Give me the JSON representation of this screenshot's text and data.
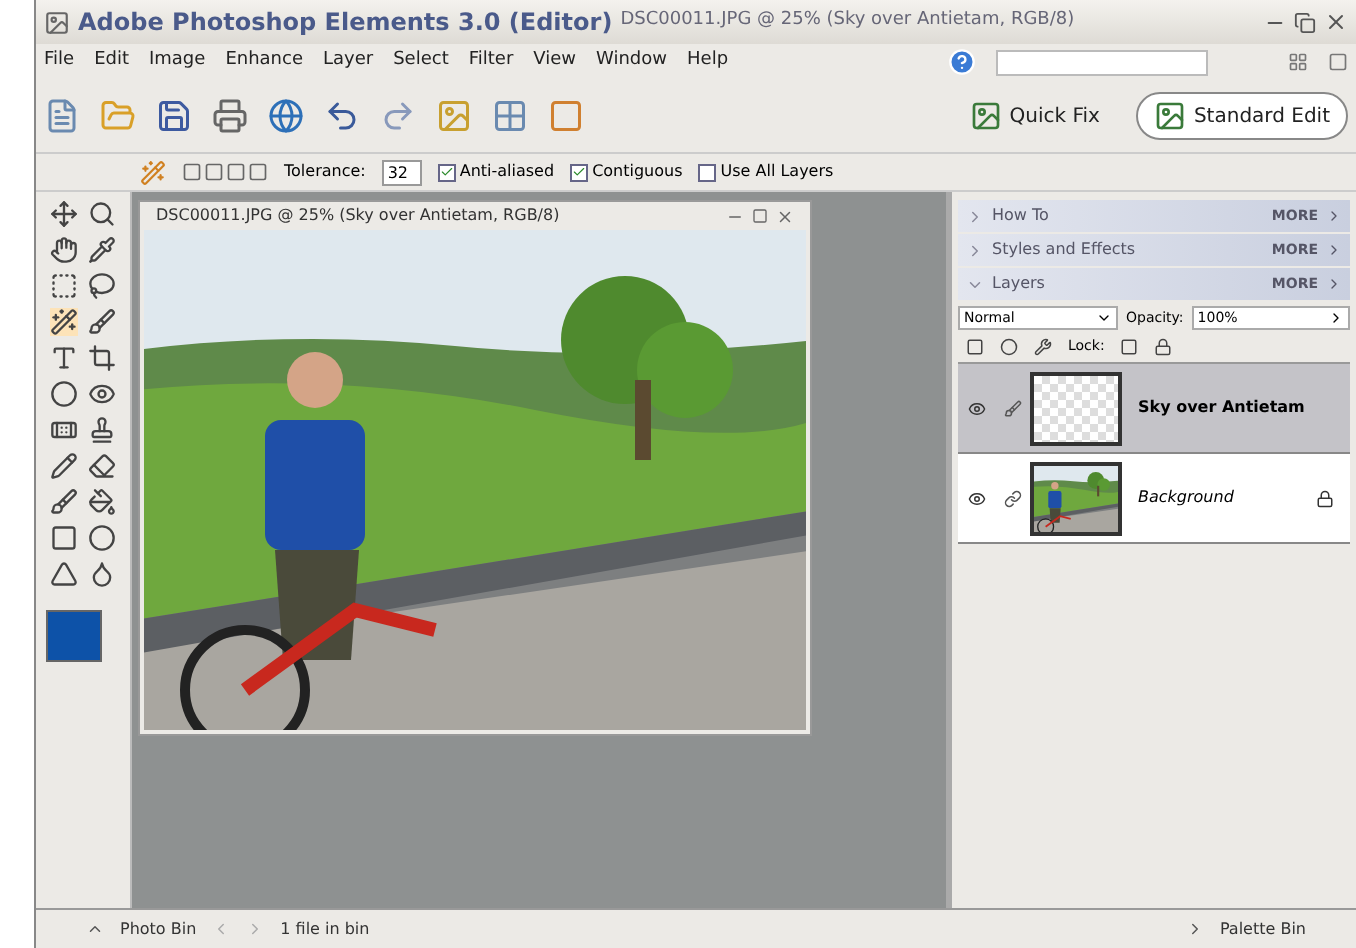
{
  "window": {
    "title": "Adobe Photoshop Elements 3.0 (Editor)",
    "document": "DSC00011.JPG @ 25% (Sky over Antietam, RGB/8)"
  },
  "menu": [
    "File",
    "Edit",
    "Image",
    "Enhance",
    "Layer",
    "Select",
    "Filter",
    "View",
    "Window",
    "Help"
  ],
  "modes": [
    {
      "label": "Quick Fix",
      "selected": false
    },
    {
      "label": "Standard Edit",
      "selected": true
    }
  ],
  "options": {
    "tolerance_label": "Tolerance:",
    "tolerance": "32",
    "checkboxes": [
      {
        "label": "Anti-aliased",
        "checked": true
      },
      {
        "label": "Contiguous",
        "checked": true
      },
      {
        "label": "Use All Layers",
        "checked": false
      }
    ]
  },
  "document_window": {
    "title": "DSC00011.JPG @ 25% (Sky over Antietam, RGB/8)"
  },
  "palettes": [
    {
      "title": "How To",
      "expanded": false,
      "more": "MORE"
    },
    {
      "title": "Styles and Effects",
      "expanded": false,
      "more": "MORE"
    },
    {
      "title": "Layers",
      "expanded": true,
      "more": "MORE"
    }
  ],
  "layers_panel": {
    "blend_mode": "Normal",
    "opacity_label": "Opacity:",
    "opacity": "100%",
    "lock_label": "Lock:",
    "layers": [
      {
        "name": "Sky over Antietam",
        "kind": "transparent",
        "selected": true
      },
      {
        "name": "Background",
        "kind": "background",
        "selected": false
      }
    ]
  },
  "status_bar": {
    "photo_bin": "Photo Bin",
    "file_count": "1 file in bin",
    "palette_bin": "Palette Bin"
  }
}
